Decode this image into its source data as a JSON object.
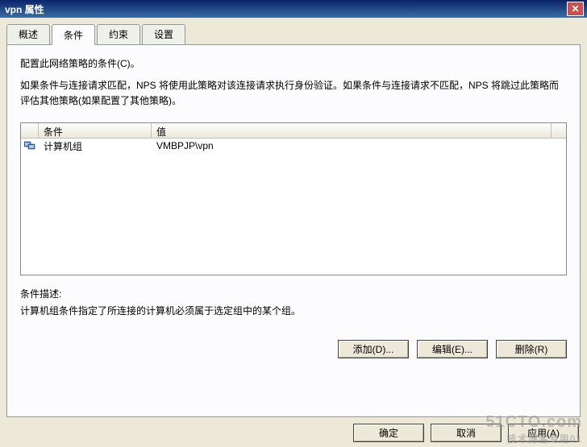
{
  "window": {
    "title": "vpn 属性",
    "close_label": "✕"
  },
  "tabs": {
    "overview": "概述",
    "conditions": "条件",
    "constraints": "约束",
    "settings": "设置"
  },
  "content": {
    "intro_line1": "配置此网络策略的条件(C)。",
    "intro_line2": "如果条件与连接请求匹配，NPS 将使用此策略对该连接请求执行身份验证。如果条件与连接请求不匹配，NPS 将跳过此策略而评估其他策略(如果配置了其他策略)。",
    "table": {
      "headers": {
        "condition": "条件",
        "value": "值"
      },
      "rows": [
        {
          "condition": "计算机组",
          "value": "VMBPJP\\vpn"
        }
      ]
    },
    "desc_label": "条件描述:",
    "desc_text": "计算机组条件指定了所连接的计算机必须属于选定组中的某个组。"
  },
  "buttons": {
    "add": "添加(D)...",
    "edit": "编辑(E)...",
    "remove": "删除(R)",
    "ok": "确定",
    "cancel": "取消",
    "apply": "应用(A)"
  },
  "watermark": {
    "main": "51CTO.com",
    "sub": "技术博客专用01"
  }
}
